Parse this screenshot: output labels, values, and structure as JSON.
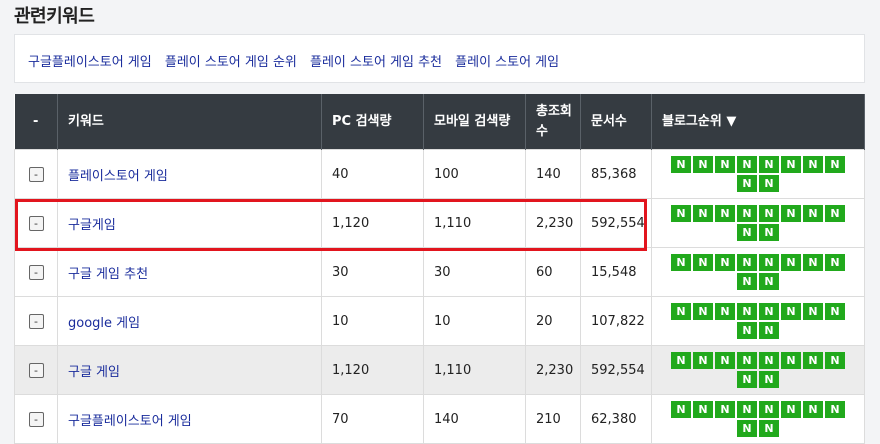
{
  "section_title": "관련키워드",
  "related_keywords": [
    "구글플레이스토어 게임",
    "플레이 스토어 게임 순위",
    "플레이 스토어 게임 추천",
    "플레이 스토어 게임"
  ],
  "table": {
    "headers": {
      "remove": "-",
      "keyword": "키워드",
      "pc": "PC 검색량",
      "mobile": "모바일 검색량",
      "total": "총조회수",
      "docs": "문서수",
      "blog_rank": "블로그순위 ▼"
    },
    "badge_label": "N",
    "minus_label": "-",
    "rows": [
      {
        "keyword": "플레이스토어 게임",
        "pc": "40",
        "mobile": "100",
        "total": "140",
        "docs": "85,368",
        "badges": 10
      },
      {
        "keyword": "구글게임",
        "pc": "1,120",
        "mobile": "1,110",
        "total": "2,230",
        "docs": "592,554",
        "badges": 10
      },
      {
        "keyword": "구글 게임 추천",
        "pc": "30",
        "mobile": "30",
        "total": "60",
        "docs": "15,548",
        "badges": 10
      },
      {
        "keyword": "google 게임",
        "pc": "10",
        "mobile": "10",
        "total": "20",
        "docs": "107,822",
        "badges": 10
      },
      {
        "keyword": "구글 게임",
        "pc": "1,120",
        "mobile": "1,110",
        "total": "2,230",
        "docs": "592,554",
        "badges": 10
      },
      {
        "keyword": "구글플레이스토어 게임",
        "pc": "70",
        "mobile": "140",
        "total": "210",
        "docs": "62,380",
        "badges": 10
      }
    ]
  },
  "colors": {
    "header_bg": "#353b41",
    "badge": "#21a91c",
    "highlight": "#e2151e",
    "link": "#1a2c9c"
  }
}
